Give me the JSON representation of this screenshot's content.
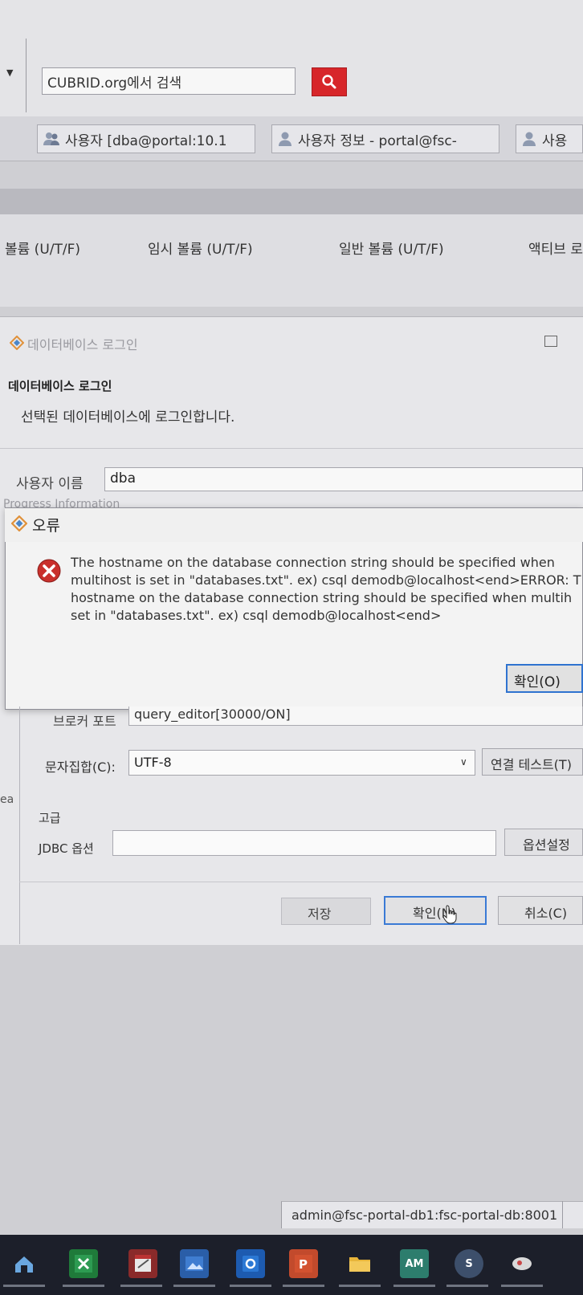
{
  "top": {
    "search_placeholder": "CUBRID.org에서 검색"
  },
  "tabs": [
    {
      "label": "사용자 [dba@portal:10.1"
    },
    {
      "label": "사용자 정보 - portal@fsc-"
    },
    {
      "label": "사용"
    }
  ],
  "table": {
    "columns": [
      "볼륨 (U/T/F)",
      "임시 볼륨 (U/T/F)",
      "일반 볼륨 (U/T/F)",
      "액티브 로"
    ]
  },
  "login_dialog": {
    "title": "데이터베이스 로그인",
    "heading": "데이터베이스 로그인",
    "description": "선택된 데이터베이스에 로그인합니다.",
    "user_label": "사용자 이름",
    "user_value": "dba",
    "progress_label": "Progress Information",
    "broker_label": "브로커 포트",
    "broker_value": "query_editor[30000/ON]",
    "charset_label": "문자집합(C):",
    "charset_value": "UTF-8",
    "conn_test_label": "연결 테스트(T)",
    "left_clip": "ea",
    "advanced_label": "고급",
    "jdbc_label": "JDBC 옵션",
    "jdbc_value": "",
    "options_button": "옵션설정",
    "save_button": "저장",
    "ok_button": "확인(N)",
    "cancel_button": "취소(C)"
  },
  "error_dialog": {
    "title": "오류",
    "message": "The hostname on the database connection string should be specified when\nmultihost is set in \"databases.txt\". ex) csql demodb@localhost<end>ERROR: T\nhostname on the database connection string should be specified when multih\nset in \"databases.txt\". ex) csql demodb@localhost<end>",
    "ok_button": "확인(O)"
  },
  "status_bar": {
    "text": "admin@fsc-portal-db1:fsc-portal-db:8001"
  },
  "taskbar": {
    "icons": [
      "start-icon",
      "excel-icon",
      "notepad-icon",
      "photos-icon",
      "outlook-icon",
      "powerpoint-icon",
      "explorer-icon",
      "am-icon",
      "s-icon",
      "other-icon"
    ],
    "labels": {
      "am": "AM",
      "s": "S"
    }
  },
  "colors": {
    "search_button": "#d7262a",
    "focus_border": "#2f73d0",
    "error_icon": "#c9302c",
    "taskbar": "#1c1f2a"
  }
}
